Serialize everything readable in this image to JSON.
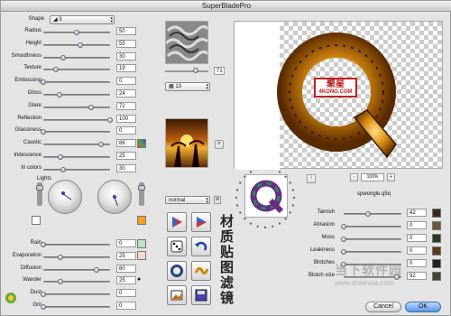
{
  "window": {
    "title": "SuperBladePro"
  },
  "shape": {
    "label": "Shape",
    "value": "3"
  },
  "sliders": [
    {
      "label": "Radius",
      "value": "50"
    },
    {
      "label": "Height",
      "value": "55"
    },
    {
      "label": "Smoothness",
      "value": "30"
    },
    {
      "label": "Texture",
      "value": "19"
    },
    {
      "label": "Embossing",
      "value": "0"
    },
    {
      "label": "Gloss",
      "value": "24"
    },
    {
      "label": "Glare",
      "value": "72"
    },
    {
      "label": "Reflection",
      "value": "100"
    },
    {
      "label": "Glassiness",
      "value": "0"
    },
    {
      "label": "Caustic",
      "value": "86"
    },
    {
      "label": "Iridescence",
      "value": "25"
    },
    {
      "label": "Iri colors",
      "value": "30"
    }
  ],
  "lights": {
    "label": "Lights"
  },
  "bottom_sliders": [
    {
      "label": "Rain",
      "value": "0"
    },
    {
      "label": "Evaporation",
      "value": "25"
    },
    {
      "label": "Diffusion",
      "value": "80"
    },
    {
      "label": "Wander",
      "value": "25"
    },
    {
      "label": "Dust",
      "value": "0"
    },
    {
      "label": "Grit",
      "value": "0"
    }
  ],
  "texture": {
    "scale_value": "71",
    "select_value": "13"
  },
  "blend": {
    "mode": "normal",
    "w_label": "W"
  },
  "tools_text": "材质贴图滤镜",
  "preview": {
    "zoom": "100%",
    "zoom_minus": "-",
    "zoom_plus": "+",
    "watermark": "4KONG.COM",
    "watermark_top": "聚星"
  },
  "preset": {
    "filename": "spwongle.q5q",
    "info_icon": "i"
  },
  "right_sliders": [
    {
      "label": "Tarnish",
      "value": "42"
    },
    {
      "label": "Abrasion",
      "value": "0"
    },
    {
      "label": "Moss",
      "value": "0"
    },
    {
      "label": "Leakiness",
      "value": "0"
    },
    {
      "label": "Blotches",
      "value": "0"
    },
    {
      "label": "Blotch size",
      "value": "92"
    }
  ],
  "buttons": {
    "cancel": "Cancel",
    "ok": "OK"
  },
  "site_watermark": {
    "line1": "当下软件园",
    "line2": "www.downxia.com"
  },
  "colors": {
    "accent": "#d8a030",
    "gold": "#c88a10",
    "green_swatch": "#bfe0b8",
    "orange_swatch": "#f0a020"
  }
}
